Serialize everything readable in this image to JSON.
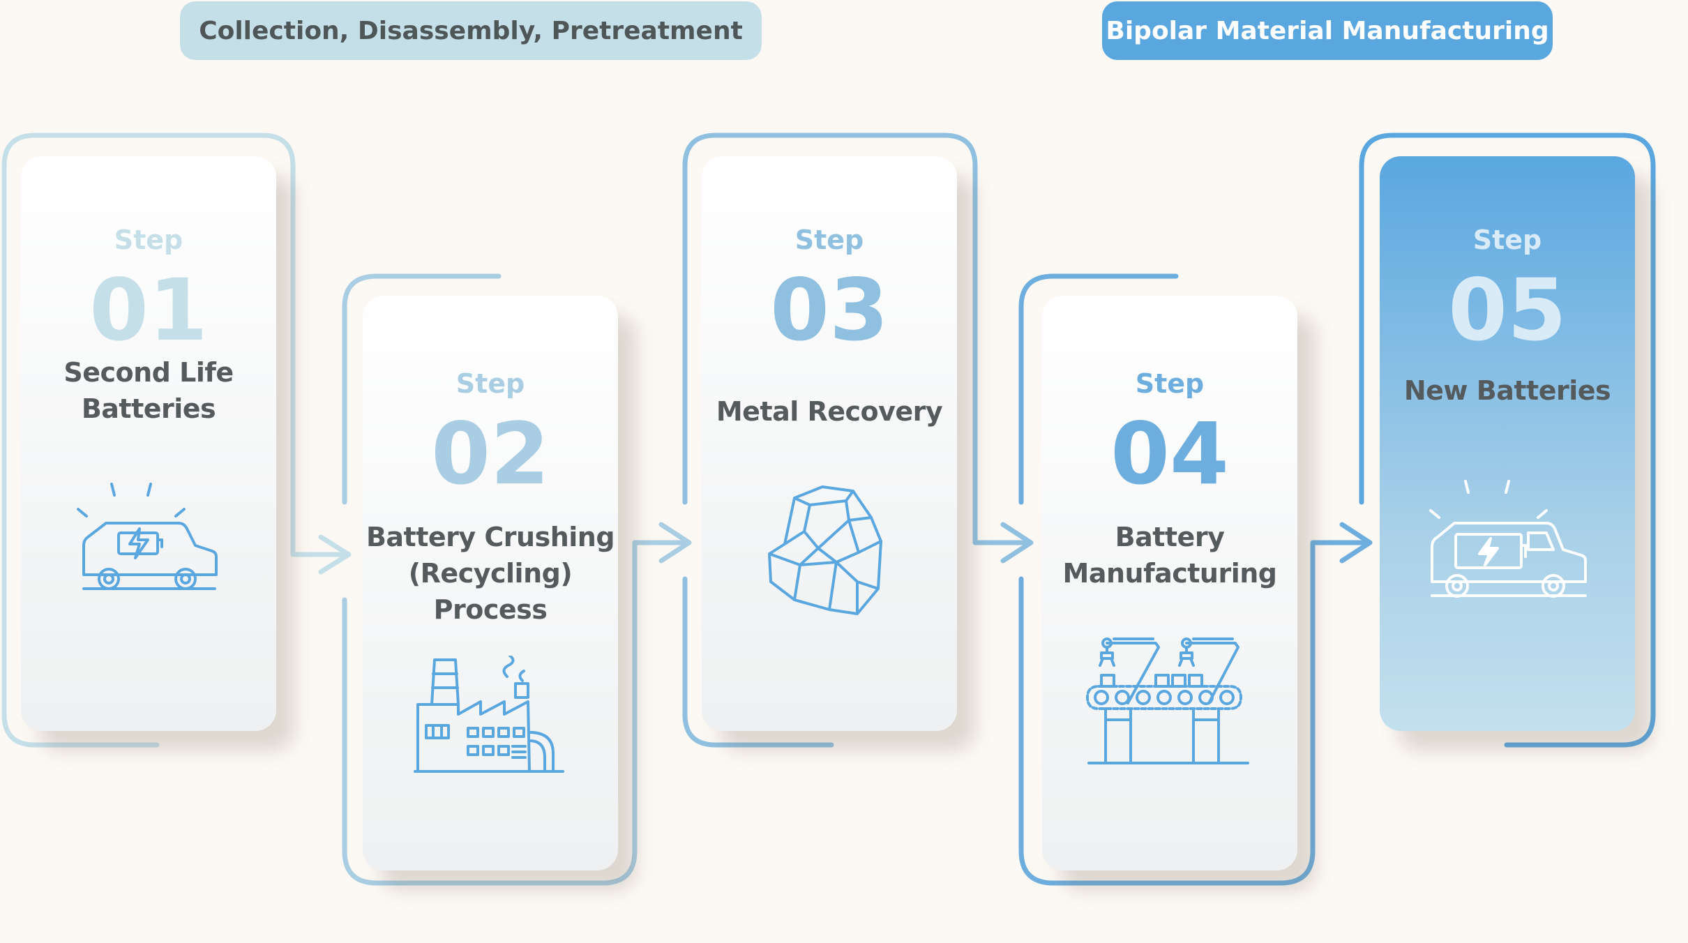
{
  "headers": {
    "left": "Collection, Disassembly, Pretreatment",
    "right": "Bipolar Material Manufacturing"
  },
  "steps": [
    {
      "label": "Step",
      "number": "01",
      "title": "Second Life\nBatteries",
      "icon": "electric-car-icon"
    },
    {
      "label": "Step",
      "number": "02",
      "title": "Battery Crushing\n(Recycling) Process",
      "icon": "factory-icon"
    },
    {
      "label": "Step",
      "number": "03",
      "title": "Metal Recovery",
      "icon": "metal-ore-icon"
    },
    {
      "label": "Step",
      "number": "04",
      "title": "Battery\nManufacturing",
      "icon": "robotic-assembly-line-icon"
    },
    {
      "label": "Step",
      "number": "05",
      "title": "New Batteries",
      "icon": "electric-car-icon"
    }
  ],
  "colors": {
    "background": "#fcf8f3",
    "light_blue": "#c5dfe9",
    "accent_blue": "#5aa7e0",
    "text_gray": "#555a5d"
  }
}
